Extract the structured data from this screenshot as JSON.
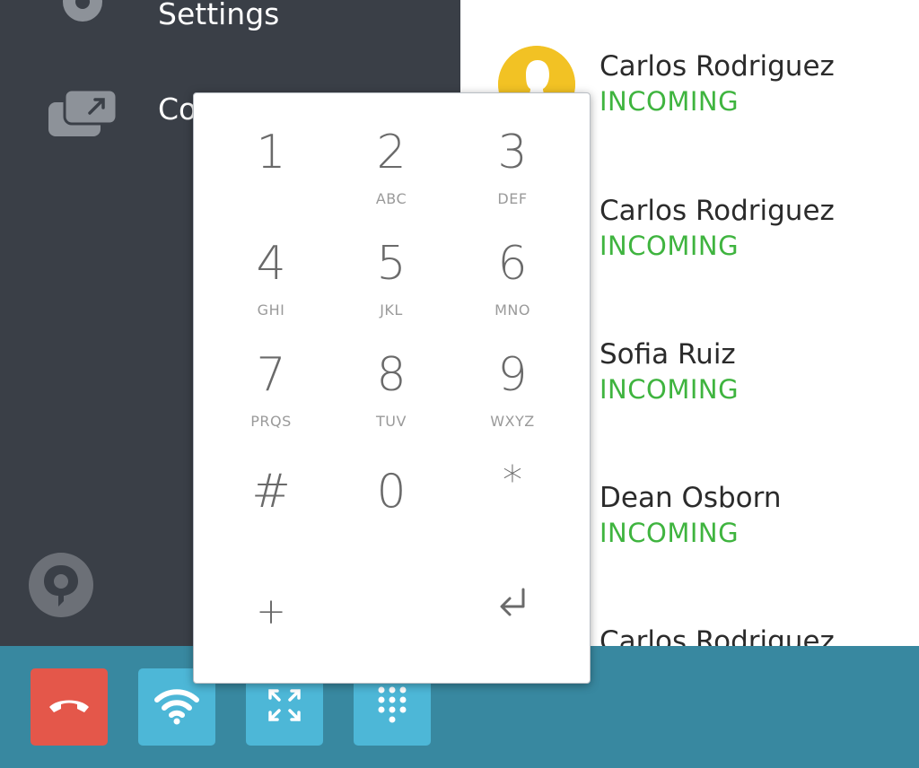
{
  "sidebar": {
    "items": [
      {
        "label": "Settings",
        "icon": "gear-icon"
      },
      {
        "label": "Co",
        "icon": "conferences-icon"
      }
    ],
    "logo_icon": "brand-logo-icon"
  },
  "calls": [
    {
      "name": "Carlos Rodriguez",
      "status": "INCOMING",
      "avatar": "person-avatar-icon"
    },
    {
      "name": "Carlos Rodriguez",
      "status": "INCOMING"
    },
    {
      "name": "Sofia Ruiz",
      "status": "INCOMING"
    },
    {
      "name": "Dean Osborn",
      "status": "INCOMING"
    },
    {
      "name": "Carlos Rodriguez",
      "status": ""
    }
  ],
  "dialpad": {
    "keys": [
      {
        "digit": "1",
        "letters": ""
      },
      {
        "digit": "2",
        "letters": "ABC"
      },
      {
        "digit": "3",
        "letters": "DEF"
      },
      {
        "digit": "4",
        "letters": "GHI"
      },
      {
        "digit": "5",
        "letters": "JKL"
      },
      {
        "digit": "6",
        "letters": "MNO"
      },
      {
        "digit": "7",
        "letters": "PRQS"
      },
      {
        "digit": "8",
        "letters": "TUV"
      },
      {
        "digit": "9",
        "letters": "WXYZ"
      },
      {
        "digit": "#",
        "letters": ""
      },
      {
        "digit": "0",
        "letters": ""
      },
      {
        "digit": "*",
        "letters": ""
      }
    ],
    "plus": "+",
    "enter_icon": "enter-icon"
  },
  "toolbar": {
    "buttons": [
      {
        "icon": "hangup-icon",
        "color": "#e4574a"
      },
      {
        "icon": "wifi-icon",
        "color": "#4db7d7"
      },
      {
        "icon": "fullscreen-icon",
        "color": "#4db7d7"
      },
      {
        "icon": "dialpad-icon",
        "color": "#4db7d7"
      }
    ]
  },
  "colors": {
    "sidebar_bg": "#3a3f47",
    "toolbar_bg": "#3888a0",
    "incoming": "#3fb43f",
    "avatar_bg": "#f2c224"
  }
}
